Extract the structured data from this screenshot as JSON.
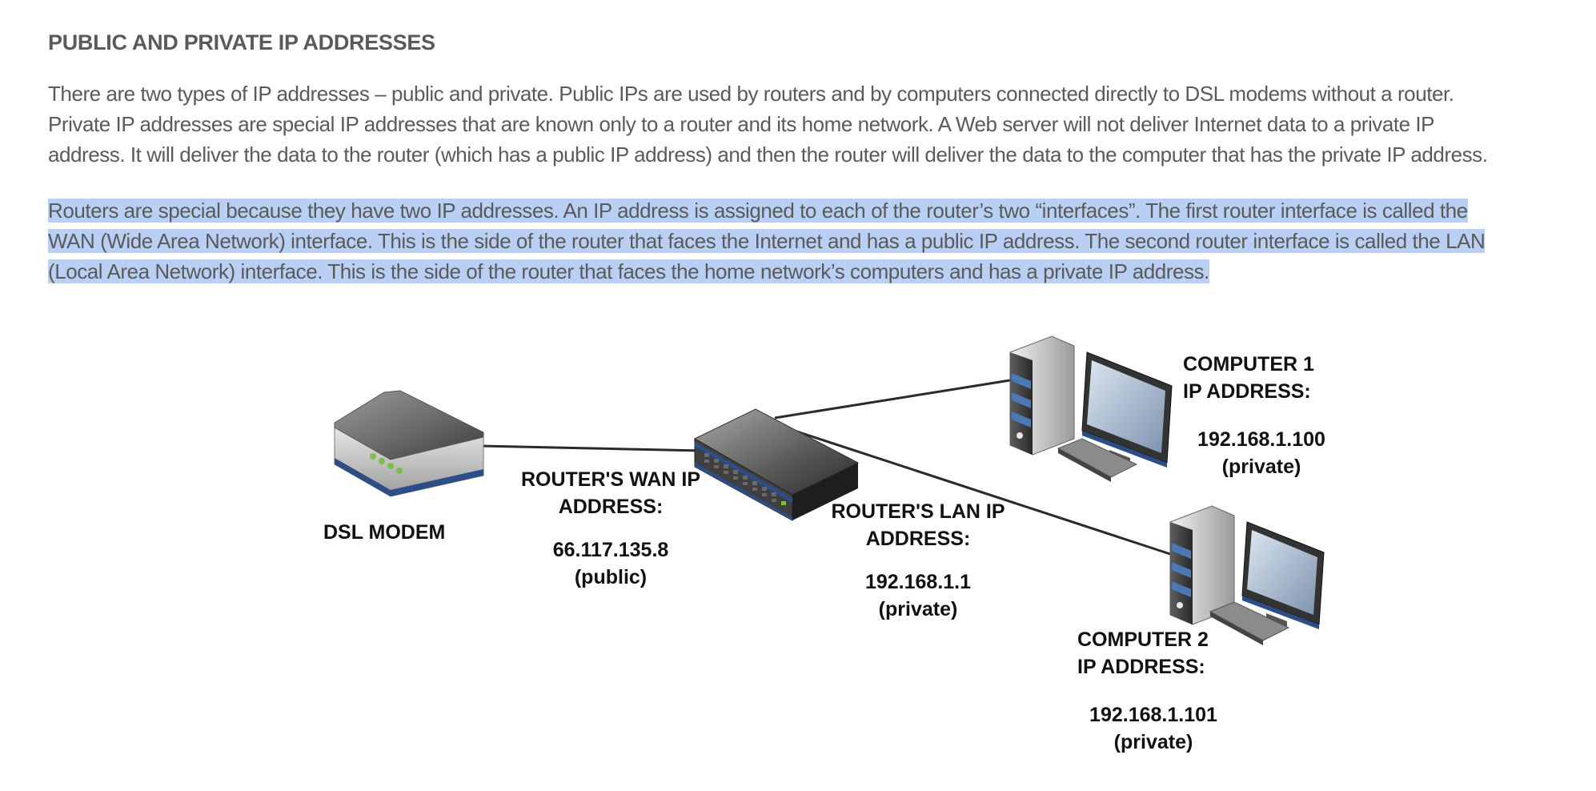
{
  "article": {
    "heading": "PUBLIC AND PRIVATE IP ADDRESSES",
    "para1": [
      "There are two types of IP addresses – public and private. Public IPs are used by routers and by computers connected directly to DSL modems without a router.",
      "Private IP addresses are special IP addresses that are known only to a router and its home network. A Web server will not deliver Internet data to a private IP",
      "address. It will deliver the data to the router (which has a public IP address) and then the router will deliver the data to the computer that has the private IP address."
    ],
    "para2": [
      "Routers are special because they have two IP addresses. An IP address is assigned to each of the router’s two “interfaces”. The first router interface is called the",
      "WAN (Wide Area Network) interface. This is the side of the router that faces the Internet and has a public IP address. The second router interface is called the LAN",
      "(Local Area Network) interface. This is the side of the router that faces the home network’s computers and has a private IP address."
    ],
    "selection_color": "#b9cff3"
  },
  "diagram": {
    "modem": {
      "label": "DSL MODEM",
      "icon": "dsl-modem-icon"
    },
    "router": {
      "icon": "router-icon"
    },
    "wan": {
      "line1": "ROUTER'S WAN IP",
      "line2": "ADDRESS:",
      "ip": "66.117.135.8",
      "scope": "(public)"
    },
    "lan": {
      "line1": "ROUTER'S LAN IP",
      "line2": "ADDRESS:",
      "ip": "192.168.1.1",
      "scope": "(private)"
    },
    "computer1": {
      "line1": "COMPUTER 1",
      "line2": "IP ADDRESS:",
      "ip": "192.168.1.100",
      "scope": "(private)",
      "icon": "desktop-computer-icon"
    },
    "computer2": {
      "line1": "COMPUTER 2",
      "line2": "IP ADDRESS:",
      "ip": "192.168.1.101",
      "scope": "(private)",
      "icon": "desktop-computer-icon"
    }
  }
}
